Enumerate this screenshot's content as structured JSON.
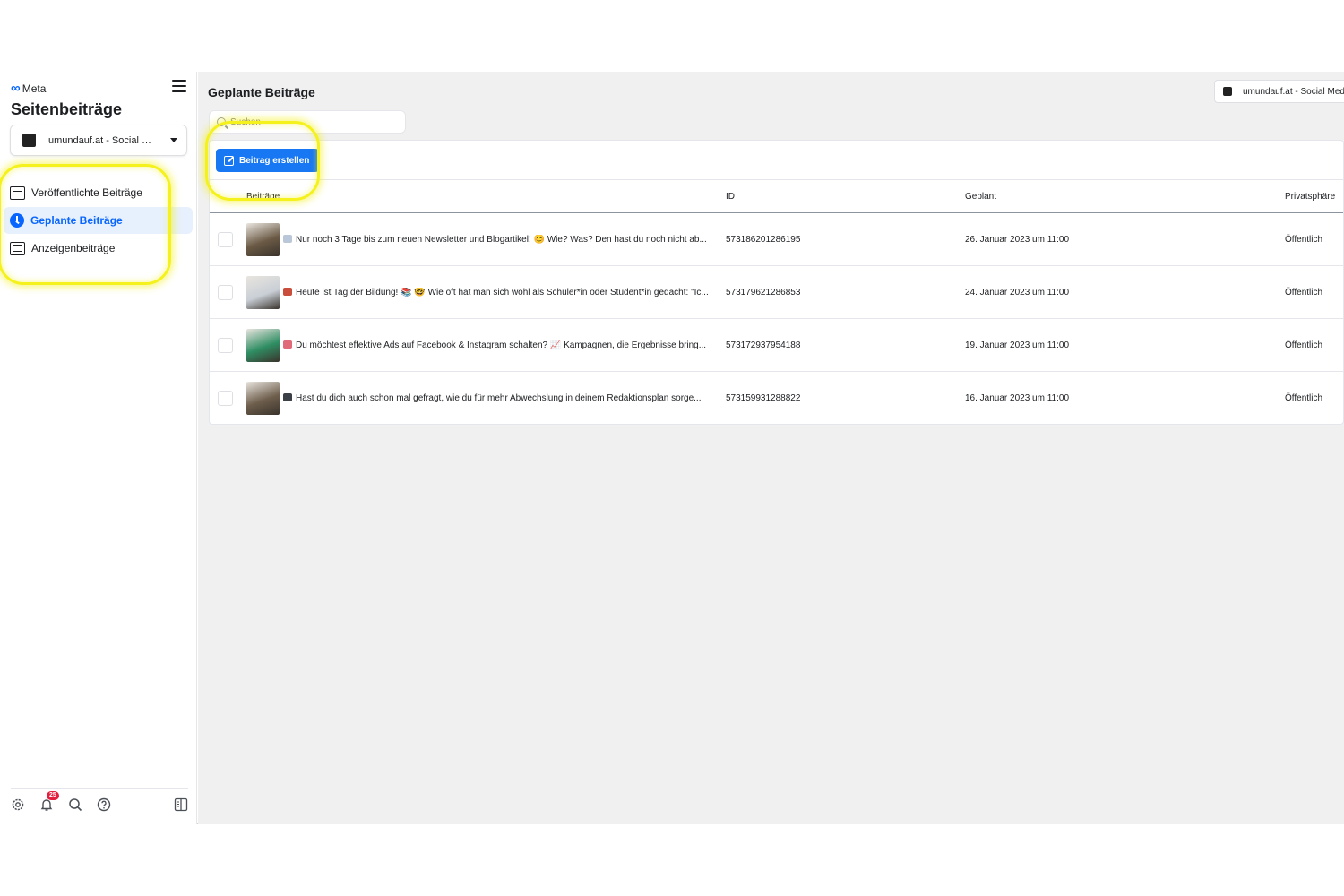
{
  "brand": "Meta",
  "sidebar": {
    "title": "Seitenbeiträge",
    "page_selector": "umundauf.at - Social Med...",
    "nav": [
      {
        "label": "Veröffentlichte Beiträge",
        "icon": "list-icon",
        "active": false
      },
      {
        "label": "Geplante Beiträge",
        "icon": "clock-icon",
        "active": true
      },
      {
        "label": "Anzeigenbeiträge",
        "icon": "ads-screen-icon",
        "active": false
      }
    ],
    "footer": {
      "notification_count": "25",
      "icons": [
        "settings-icon",
        "notifications-icon",
        "search-icon",
        "help-icon",
        "panel-toggle-icon"
      ]
    }
  },
  "main": {
    "title": "Geplante Beiträge",
    "top_page_selector": "umundauf.at - Social Med",
    "search_placeholder": "Suchen",
    "create_button": "Beitrag erstellen",
    "columns": [
      "Beiträge",
      "ID",
      "Geplant",
      "Privatsphäre"
    ],
    "rows": [
      {
        "post": "Nur noch 3 Tage bis zum neuen Newsletter und Blogartikel! 😊 Wie? Was? Den hast du noch nicht ab...",
        "id": "573186201286195",
        "scheduled": "26. Januar 2023 um 11:00",
        "privacy": "Öffentlich",
        "emoji_color": "#b9c7d8",
        "thumb_color": "#6b5a45"
      },
      {
        "post": "Heute ist Tag der Bildung! 📚 🤓 Wie oft hat man sich wohl als Schüler*in oder Student*in gedacht: \"Ic...",
        "id": "573179621286853",
        "scheduled": "24. Januar 2023 um 11:00",
        "privacy": "Öffentlich",
        "emoji_color": "#c94f3c",
        "thumb_color": "#c9cfd6"
      },
      {
        "post": "Du möchtest effektive Ads auf Facebook & Instagram schalten? 📈 Kampagnen, die Ergebnisse bring...",
        "id": "573172937954188",
        "scheduled": "19. Januar 2023 um 11:00",
        "privacy": "Öffentlich",
        "emoji_color": "#e06a78",
        "thumb_color": "#2f8e63"
      },
      {
        "post": "Hast du dich auch schon mal gefragt, wie du für mehr Abwechslung in deinem Redaktionsplan sorge...",
        "id": "573159931288822",
        "scheduled": "16. Januar 2023 um 11:00",
        "privacy": "Öffentlich",
        "emoji_color": "#3b3f46",
        "thumb_color": "#6e5e4c"
      }
    ]
  },
  "colors": {
    "accent": "#1877f2",
    "active_bg": "#e7f0fd",
    "highlight": "#f4f11d",
    "badge": "#e41e3f"
  }
}
